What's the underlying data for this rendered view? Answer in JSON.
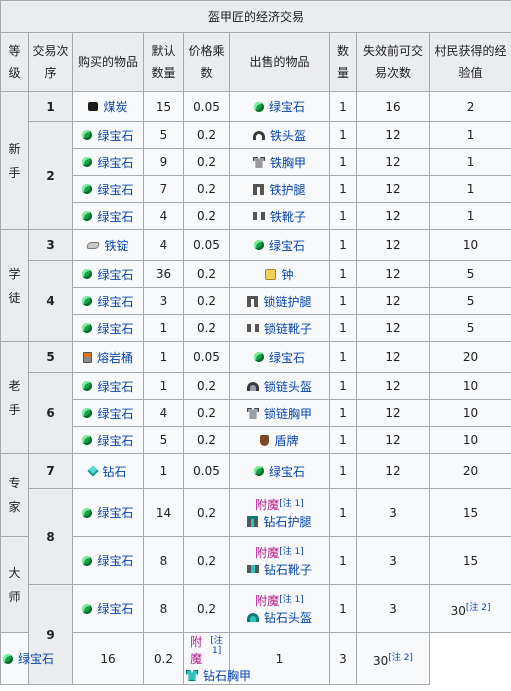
{
  "title": "盔甲匠的经济交易",
  "headers": {
    "level": "等级",
    "trade_order": "交易次序",
    "buy_item": "购买的物品",
    "default_qty": "默认数量",
    "price_mult": "价格乘数",
    "sell_item": "出售的物品",
    "qty": "数量",
    "max_uses": "失效前可交易次数",
    "villager_xp": "村民获得的经验值"
  },
  "levels": [
    {
      "name": "新手"
    },
    {
      "name": "学徒"
    },
    {
      "name": "老手"
    },
    {
      "name": "专家"
    },
    {
      "name": "大师"
    }
  ],
  "rows": [
    {
      "order": "1",
      "buy": {
        "icon": "coal-icon",
        "name": "煤炭"
      },
      "qty": "15",
      "mult": "0.05",
      "sell": {
        "icon": "emerald-icon",
        "name": "绿宝石"
      },
      "sell_qty": "1",
      "uses": "16",
      "xp": "2"
    },
    {
      "order": "2",
      "buy": {
        "icon": "emerald-icon",
        "name": "绿宝石"
      },
      "qty": "5",
      "mult": "0.2",
      "sell": {
        "icon": "iron-helmet-icon",
        "name": "铁头盔"
      },
      "sell_qty": "1",
      "uses": "12",
      "xp": "1"
    },
    {
      "order": "",
      "buy": {
        "icon": "emerald-icon",
        "name": "绿宝石"
      },
      "qty": "9",
      "mult": "0.2",
      "sell": {
        "icon": "iron-chestplate-icon",
        "name": "铁胸甲"
      },
      "sell_qty": "1",
      "uses": "12",
      "xp": "1"
    },
    {
      "order": "",
      "buy": {
        "icon": "emerald-icon",
        "name": "绿宝石"
      },
      "qty": "7",
      "mult": "0.2",
      "sell": {
        "icon": "iron-leggings-icon",
        "name": "铁护腿"
      },
      "sell_qty": "1",
      "uses": "12",
      "xp": "1"
    },
    {
      "order": "",
      "buy": {
        "icon": "emerald-icon",
        "name": "绿宝石"
      },
      "qty": "4",
      "mult": "0.2",
      "sell": {
        "icon": "iron-boots-icon",
        "name": "铁靴子"
      },
      "sell_qty": "1",
      "uses": "12",
      "xp": "1"
    },
    {
      "order": "3",
      "buy": {
        "icon": "iron-ingot-icon",
        "name": "铁锭"
      },
      "qty": "4",
      "mult": "0.05",
      "sell": {
        "icon": "emerald-icon",
        "name": "绿宝石"
      },
      "sell_qty": "1",
      "uses": "12",
      "xp": "10"
    },
    {
      "order": "4",
      "buy": {
        "icon": "emerald-icon",
        "name": "绿宝石"
      },
      "qty": "36",
      "mult": "0.2",
      "sell": {
        "icon": "bell-icon",
        "name": "钟"
      },
      "sell_qty": "1",
      "uses": "12",
      "xp": "5"
    },
    {
      "order": "",
      "buy": {
        "icon": "emerald-icon",
        "name": "绿宝石"
      },
      "qty": "3",
      "mult": "0.2",
      "sell": {
        "icon": "chainmail-leggings-icon",
        "name": "锁链护腿"
      },
      "sell_qty": "1",
      "uses": "12",
      "xp": "5"
    },
    {
      "order": "",
      "buy": {
        "icon": "emerald-icon",
        "name": "绿宝石"
      },
      "qty": "1",
      "mult": "0.2",
      "sell": {
        "icon": "chainmail-boots-icon",
        "name": "锁链靴子"
      },
      "sell_qty": "1",
      "uses": "12",
      "xp": "5"
    },
    {
      "order": "5",
      "buy": {
        "icon": "lava-bucket-icon",
        "name": "熔岩桶"
      },
      "qty": "1",
      "mult": "0.05",
      "sell": {
        "icon": "emerald-icon",
        "name": "绿宝石"
      },
      "sell_qty": "1",
      "uses": "12",
      "xp": "20"
    },
    {
      "order": "6",
      "buy": {
        "icon": "emerald-icon",
        "name": "绿宝石"
      },
      "qty": "1",
      "mult": "0.2",
      "sell": {
        "icon": "chainmail-helmet-icon",
        "name": "锁链头盔"
      },
      "sell_qty": "1",
      "uses": "12",
      "xp": "10"
    },
    {
      "order": "",
      "buy": {
        "icon": "emerald-icon",
        "name": "绿宝石"
      },
      "qty": "4",
      "mult": "0.2",
      "sell": {
        "icon": "chainmail-chestplate-icon",
        "name": "锁链胸甲"
      },
      "sell_qty": "1",
      "uses": "12",
      "xp": "10"
    },
    {
      "order": "",
      "buy": {
        "icon": "emerald-icon",
        "name": "绿宝石"
      },
      "qty": "5",
      "mult": "0.2",
      "sell": {
        "icon": "shield-icon",
        "name": "盾牌"
      },
      "sell_qty": "1",
      "uses": "12",
      "xp": "10"
    },
    {
      "order": "7",
      "buy": {
        "icon": "diamond-icon",
        "name": "钻石"
      },
      "qty": "1",
      "mult": "0.05",
      "sell": {
        "icon": "emerald-icon",
        "name": "绿宝石"
      },
      "sell_qty": "1",
      "uses": "12",
      "xp": "20"
    },
    {
      "order": "8",
      "buy": {
        "icon": "emerald-icon",
        "name": "绿宝石"
      },
      "qty": "14",
      "mult": "0.2",
      "sell": {
        "icon": "diamond-leggings-icon",
        "name": "钻石护腿",
        "prefix": "附魔",
        "note": "[注 1]"
      },
      "sell_qty": "1",
      "uses": "3",
      "xp": "15"
    },
    {
      "order": "",
      "buy": {
        "icon": "emerald-icon",
        "name": "绿宝石"
      },
      "qty": "8",
      "mult": "0.2",
      "sell": {
        "icon": "diamond-boots-icon",
        "name": "钻石靴子",
        "prefix": "附魔",
        "note": "[注 1]"
      },
      "sell_qty": "1",
      "uses": "3",
      "xp": "15"
    },
    {
      "order": "9",
      "buy": {
        "icon": "emerald-icon",
        "name": "绿宝石"
      },
      "qty": "8",
      "mult": "0.2",
      "sell": {
        "icon": "diamond-helmet-icon",
        "name": "钻石头盔",
        "prefix": "附魔",
        "note": "[注 1]"
      },
      "sell_qty": "1",
      "uses": "3",
      "xp": "30",
      "xp_note": "[注 2]"
    },
    {
      "order": "",
      "buy": {
        "icon": "emerald-icon",
        "name": "绿宝石"
      },
      "qty": "16",
      "mult": "0.2",
      "sell": {
        "icon": "diamond-chestplate-icon",
        "name": "钻石胸甲",
        "prefix": "附魔",
        "note": "[注 1]"
      },
      "sell_qty": "1",
      "uses": "3",
      "xp": "30",
      "xp_note": "[注 2]"
    }
  ]
}
